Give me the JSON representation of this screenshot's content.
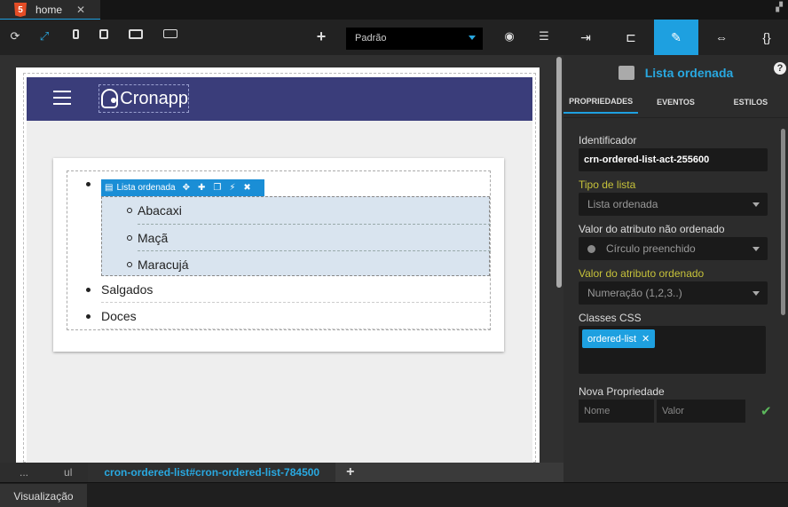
{
  "tabbar": {
    "tab_label": "home",
    "tab_icon": "html5-icon",
    "close_glyph": "✕"
  },
  "toolbar": {
    "buttons": [
      "refresh-icon",
      "expand-icon",
      "phone-icon",
      "tablet-icon",
      "desktop-icon",
      "monitor-icon",
      "add-icon",
      "hide-icon",
      "database-icon"
    ],
    "theme_select": "Padrão"
  },
  "right_toolbar": {
    "buttons": [
      "export-icon",
      "tree-icon",
      "edit-icon",
      "resize-icon",
      "code-icon"
    ],
    "active": "edit-icon"
  },
  "canvas": {
    "brand": "Cronapp",
    "component_bar_label": "Lista ordenada",
    "sublist_items": [
      "Abacaxi",
      "Maçã",
      "Maracujá"
    ],
    "list_items": [
      "Salgados",
      "Doces"
    ]
  },
  "breadcrumb": {
    "items": [
      "...",
      "ul",
      "cron-ordered-list#cron-ordered-list-784500"
    ],
    "add": "+"
  },
  "bottom": {
    "tab": "Visualização"
  },
  "panel": {
    "title": "Lista ordenada",
    "help": "?",
    "tabs": [
      "PROPRIEDADES",
      "EVENTOS",
      "ESTILOS"
    ],
    "identificador_label": "Identificador",
    "identificador_value": "crn-ordered-list-act-255600",
    "tipo_label": "Tipo de lista",
    "tipo_value": "Lista ordenada",
    "nao_ordenado_label": "Valor do atributo não ordenado",
    "nao_ordenado_value": "Círculo preenchido",
    "ordenado_label": "Valor do atributo ordenado",
    "ordenado_value": "Numeração (1,2,3..)",
    "css_label": "Classes CSS",
    "css_tag": "ordered-list",
    "nova_label": "Nova Propriedade",
    "nome_placeholder": "Nome",
    "valor_placeholder": "Valor"
  },
  "colors": {
    "accent": "#1ea0e0",
    "header": "#3a3d7a",
    "yellow_label": "#c6c23a"
  }
}
